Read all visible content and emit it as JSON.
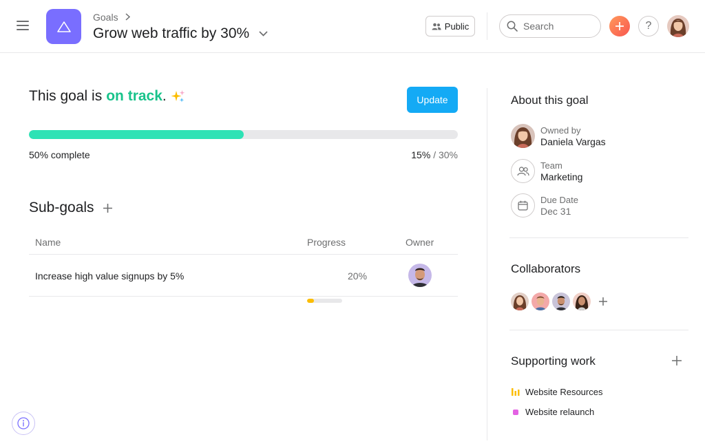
{
  "header": {
    "breadcrumb": "Goals",
    "title": "Grow web traffic by 30%",
    "privacy_label": "Public",
    "search_placeholder": "Search",
    "help_label": "?"
  },
  "status": {
    "prefix": "This goal is",
    "state": "on track",
    "suffix": ".",
    "update_label": "Update",
    "progress_fraction": 0.5,
    "progress_label": "50% complete",
    "current_value": "15%",
    "target_value": "/ 30%"
  },
  "subgoals": {
    "title": "Sub-goals",
    "columns": {
      "name": "Name",
      "progress": "Progress",
      "owner": "Owner"
    },
    "rows": [
      {
        "name": "Increase high value signups by 5%",
        "progress_fraction": 0.2,
        "progress_label": "20%"
      }
    ]
  },
  "about": {
    "title": "About this goal",
    "owner_label": "Owned by",
    "owner_value": "Daniela Vargas",
    "team_label": "Team",
    "team_value": "Marketing",
    "due_label": "Due Date",
    "due_value": "Dec 31"
  },
  "collaborators": {
    "title": "Collaborators"
  },
  "supporting_work": {
    "title": "Supporting work",
    "items": [
      {
        "label": "Website Resources",
        "icon": "bar-chart-icon",
        "color": "#fcbd01"
      },
      {
        "label": "Website relaunch",
        "icon": "project-dot-icon",
        "color": "#e362e3"
      }
    ]
  },
  "colors": {
    "accent": "#14aaf5",
    "goal_icon": "#796eff",
    "on_track": "#19c38b",
    "progress": "#2ee2b5",
    "subgoal_progress": "#fcbd01"
  }
}
